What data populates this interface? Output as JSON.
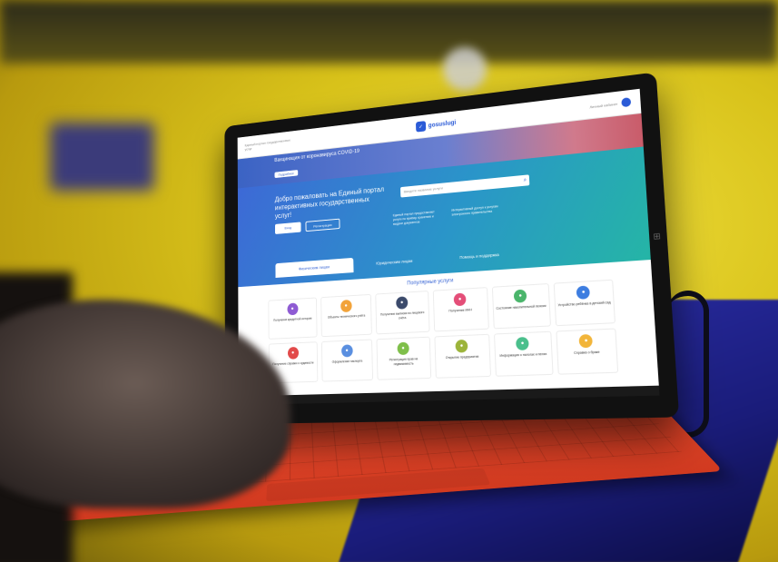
{
  "site": {
    "header_subtitle": "Единый портал государственных услуг",
    "logo_text": "gosuslugi",
    "header_right": "Личный кабинет"
  },
  "banner": {
    "text": "Вакцинация от коронавируса COVID-19",
    "button": "Подробнее"
  },
  "hero": {
    "title": "Добро пожаловать на Единый портал интерактивных государственных услуг!",
    "search_placeholder": "Введите название услуги",
    "login_label": "Вход",
    "register_label": "Регистрация",
    "note_1": "Единый портал предоставляет услуги по приёму, хранению и выдаче документов",
    "note_2": "Интерактивный доступ к услугам электронного правительства"
  },
  "tabs": [
    "Физическим лицам",
    "Юридическим лицам",
    "Помощь и поддержка"
  ],
  "services": {
    "title": "Популярные услуги",
    "items": [
      {
        "label": "Получение кредитной истории",
        "color": "#8e5bd3",
        "new": true
      },
      {
        "label": "Объекты технического учёта",
        "color": "#f2a33a",
        "new": true
      },
      {
        "label": "Получение выписки из лицевого счёта",
        "color": "#3b4a6b",
        "new": true
      },
      {
        "label": "Получение ИНН",
        "color": "#e44e78",
        "new": false
      },
      {
        "label": "Состояние накопительной пенсии",
        "color": "#4ab56b",
        "new": false
      },
      {
        "label": "Устройство ребёнка в детский сад",
        "color": "#3d7de0",
        "new": false
      },
      {
        "label": "Получение справки о судимости",
        "color": "#e24a4a",
        "new": false
      },
      {
        "label": "Оформление паспорта",
        "color": "#5a8fe0",
        "new": false
      },
      {
        "label": "Регистрация прав на недвижимость",
        "color": "#7fbf4a",
        "new": false
      },
      {
        "label": "Открытие предприятия",
        "color": "#9cb43a",
        "new": false
      },
      {
        "label": "Информация о налогах и пенях",
        "color": "#4abf8c",
        "new": false
      },
      {
        "label": "Справка о браке",
        "color": "#f2b53a",
        "new": false
      }
    ]
  }
}
